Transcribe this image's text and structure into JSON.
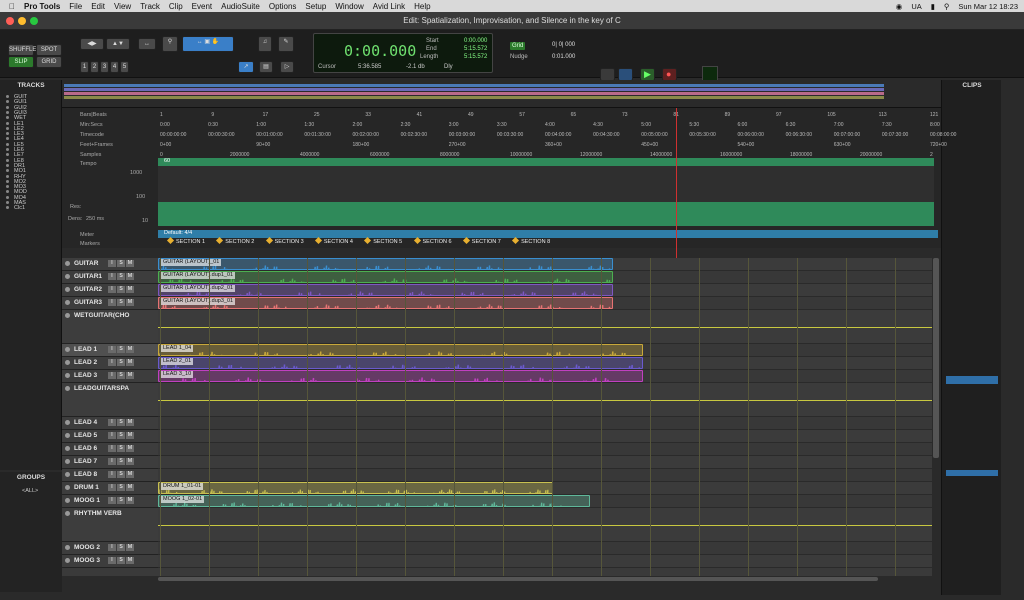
{
  "menubar": {
    "app": "Pro Tools",
    "items": [
      "File",
      "Edit",
      "View",
      "Track",
      "Clip",
      "Event",
      "AudioSuite",
      "Options",
      "Setup",
      "Window",
      "Avid Link",
      "Help"
    ],
    "right": {
      "lang": "UA",
      "datetime": "Sun Mar 12  18:23"
    }
  },
  "window": {
    "title": "Edit: Spatialization, Improvisation, and Silence in the key of C"
  },
  "toolbar": {
    "shuffle": "SHUFFLE",
    "spot": "SPOT",
    "slip": "SLIP",
    "grid": "GRID",
    "zoom_presets": [
      "1",
      "2",
      "3",
      "4",
      "5"
    ]
  },
  "counter": {
    "main": "0:00.000",
    "start_label": "Start",
    "end_label": "End",
    "length_label": "Length",
    "start": "0:00.000",
    "end": "5:15.572",
    "length": "5:15.572",
    "cursor_label": "Cursor",
    "cursor": "5:36.585",
    "level": "-2.1 db",
    "dly": "Dly"
  },
  "grid": {
    "label": "Grid",
    "value": "0| 0| 000",
    "nudge_label": "Nudge",
    "nudge_value": "0:01.000"
  },
  "tracks_panel": {
    "title": "TRACKS",
    "items": [
      "GUIT",
      "GUI1",
      "GUI2",
      "GUI3",
      "WET",
      "LE1",
      "LE2",
      "LE3",
      "LE4",
      "LE5",
      "LE6",
      "LE7",
      "LE8",
      "DR1",
      "MO1",
      "RHY",
      "MO2",
      "MO3",
      "MOD",
      "MO4",
      "MAS",
      "Clc1"
    ]
  },
  "groups_panel": {
    "title": "GROUPS",
    "all": "<ALL>"
  },
  "clips_panel": {
    "title": "CLIPS"
  },
  "rulers": {
    "labels": [
      "Bars|Beats",
      "Min:Secs",
      "Timecode",
      "Feet+Frames",
      "Samples",
      "Tempo"
    ],
    "bars": [
      "1",
      "9",
      "17",
      "25",
      "33",
      "41",
      "49",
      "57",
      "65",
      "73",
      "81",
      "89",
      "97",
      "105",
      "113",
      "121"
    ],
    "minsecs": [
      "0:00",
      "0:30",
      "1:00",
      "1:30",
      "2:00",
      "2:30",
      "3:00",
      "3:30",
      "4:00",
      "4:30",
      "5:00",
      "5:30",
      "6:00",
      "6:30",
      "7:00",
      "7:30",
      "8:00"
    ],
    "timecode": [
      "00:00:00:00",
      "00:00:30:00",
      "00:01:00:00",
      "00:01:30:00",
      "00:02:00:00",
      "00:02:30:00",
      "00:03:00:00",
      "00:03:30:00",
      "00:04:00:00",
      "00:04:30:00",
      "00:05:00:00",
      "00:05:30:00",
      "00:06:00:00",
      "00:06:30:00",
      "00:07:00:00",
      "00:07:30:00",
      "00:08:00:00"
    ],
    "feet": [
      "0+00",
      "90+00",
      "180+00",
      "270+00",
      "360+00",
      "450+00",
      "540+00",
      "630+00",
      "720+00"
    ],
    "samples": [
      "0",
      "2000000",
      "4000000",
      "6000000",
      "8000000",
      "10000000",
      "12000000",
      "14000000",
      "16000000",
      "18000000",
      "20000000",
      "2"
    ],
    "tempo_value": "60",
    "tempo_scale": [
      "1000",
      "100",
      "10"
    ],
    "res_label": "Res:",
    "dens_label": "Dens:",
    "dens_value": "250 ms",
    "meter_label": "Meter",
    "meter_value": "Default: 4/4",
    "markers_label": "Markers"
  },
  "markers": [
    "SECTION 1",
    "SECTION 2",
    "SECTION 3",
    "SECTION 4",
    "SECTION 5",
    "SECTION 6",
    "SECTION 7",
    "SECTION 8"
  ],
  "tracks": [
    {
      "name": "GUITAR",
      "clip": "GUITAR (LAYOUT)_01"
    },
    {
      "name": "GUITAR1",
      "clip": "GUITAR (LAYOUT).dup1_01"
    },
    {
      "name": "GUITAR2",
      "clip": "GUITAR (LAYOUT).dup2_01"
    },
    {
      "name": "GUITAR3",
      "clip": "GUITAR (LAYOUT).dup3_01"
    },
    {
      "name": "WETGUITAR(CHO",
      "clip": ""
    },
    {
      "name": "LEAD 1",
      "clip": "LEAD 1_04"
    },
    {
      "name": "LEAD 2",
      "clip": "LEAD 2_01"
    },
    {
      "name": "LEAD 3",
      "clip": "LEAD 3_10"
    },
    {
      "name": "LEADGUITARSPA",
      "clip": ""
    },
    {
      "name": "LEAD 4",
      "clip": ""
    },
    {
      "name": "LEAD 5",
      "clip": ""
    },
    {
      "name": "LEAD 6",
      "clip": ""
    },
    {
      "name": "LEAD 7",
      "clip": ""
    },
    {
      "name": "LEAD 8",
      "clip": ""
    },
    {
      "name": "DRUM 1",
      "clip": "DRUM 1_01-01"
    },
    {
      "name": "MOOG 1",
      "clip": "MOOG 1_02-01"
    },
    {
      "name": "RHYTHM VERB",
      "clip": ""
    },
    {
      "name": "MOOG 2",
      "clip": ""
    },
    {
      "name": "MOOG 3",
      "clip": ""
    }
  ],
  "colors": {
    "guitar": "#3a8fd0",
    "guitar1": "#4caf50",
    "guitar2": "#7e57c2",
    "guitar3": "#e57373",
    "lead1": "#c8a83a",
    "lead2": "#6a5acd",
    "lead3": "#c040c0",
    "drum": "#c8c050",
    "moog": "#5fb89a",
    "tempo": "#2f8a5a",
    "meter": "#2f7ea8"
  }
}
